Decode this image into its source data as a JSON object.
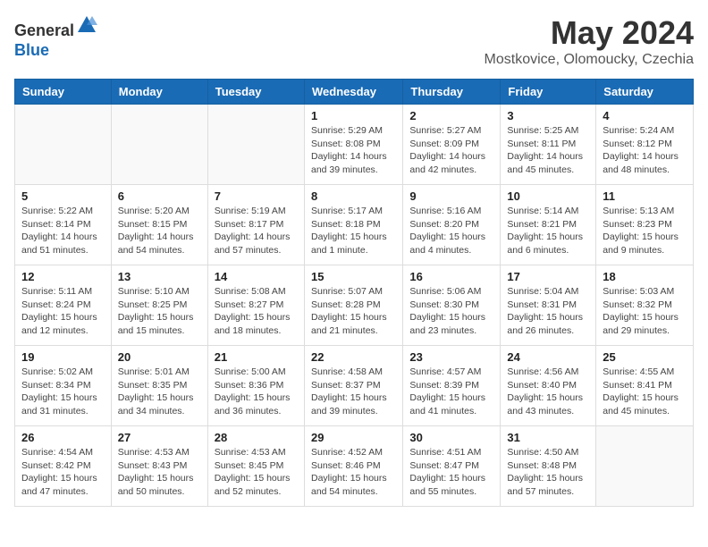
{
  "header": {
    "logo_line1": "General",
    "logo_line2": "Blue",
    "title": "May 2024",
    "location": "Mostkovice, Olomoucky, Czechia"
  },
  "weekdays": [
    "Sunday",
    "Monday",
    "Tuesday",
    "Wednesday",
    "Thursday",
    "Friday",
    "Saturday"
  ],
  "weeks": [
    [
      {
        "day": "",
        "info": ""
      },
      {
        "day": "",
        "info": ""
      },
      {
        "day": "",
        "info": ""
      },
      {
        "day": "1",
        "info": "Sunrise: 5:29 AM\nSunset: 8:08 PM\nDaylight: 14 hours\nand 39 minutes."
      },
      {
        "day": "2",
        "info": "Sunrise: 5:27 AM\nSunset: 8:09 PM\nDaylight: 14 hours\nand 42 minutes."
      },
      {
        "day": "3",
        "info": "Sunrise: 5:25 AM\nSunset: 8:11 PM\nDaylight: 14 hours\nand 45 minutes."
      },
      {
        "day": "4",
        "info": "Sunrise: 5:24 AM\nSunset: 8:12 PM\nDaylight: 14 hours\nand 48 minutes."
      }
    ],
    [
      {
        "day": "5",
        "info": "Sunrise: 5:22 AM\nSunset: 8:14 PM\nDaylight: 14 hours\nand 51 minutes."
      },
      {
        "day": "6",
        "info": "Sunrise: 5:20 AM\nSunset: 8:15 PM\nDaylight: 14 hours\nand 54 minutes."
      },
      {
        "day": "7",
        "info": "Sunrise: 5:19 AM\nSunset: 8:17 PM\nDaylight: 14 hours\nand 57 minutes."
      },
      {
        "day": "8",
        "info": "Sunrise: 5:17 AM\nSunset: 8:18 PM\nDaylight: 15 hours\nand 1 minute."
      },
      {
        "day": "9",
        "info": "Sunrise: 5:16 AM\nSunset: 8:20 PM\nDaylight: 15 hours\nand 4 minutes."
      },
      {
        "day": "10",
        "info": "Sunrise: 5:14 AM\nSunset: 8:21 PM\nDaylight: 15 hours\nand 6 minutes."
      },
      {
        "day": "11",
        "info": "Sunrise: 5:13 AM\nSunset: 8:23 PM\nDaylight: 15 hours\nand 9 minutes."
      }
    ],
    [
      {
        "day": "12",
        "info": "Sunrise: 5:11 AM\nSunset: 8:24 PM\nDaylight: 15 hours\nand 12 minutes."
      },
      {
        "day": "13",
        "info": "Sunrise: 5:10 AM\nSunset: 8:25 PM\nDaylight: 15 hours\nand 15 minutes."
      },
      {
        "day": "14",
        "info": "Sunrise: 5:08 AM\nSunset: 8:27 PM\nDaylight: 15 hours\nand 18 minutes."
      },
      {
        "day": "15",
        "info": "Sunrise: 5:07 AM\nSunset: 8:28 PM\nDaylight: 15 hours\nand 21 minutes."
      },
      {
        "day": "16",
        "info": "Sunrise: 5:06 AM\nSunset: 8:30 PM\nDaylight: 15 hours\nand 23 minutes."
      },
      {
        "day": "17",
        "info": "Sunrise: 5:04 AM\nSunset: 8:31 PM\nDaylight: 15 hours\nand 26 minutes."
      },
      {
        "day": "18",
        "info": "Sunrise: 5:03 AM\nSunset: 8:32 PM\nDaylight: 15 hours\nand 29 minutes."
      }
    ],
    [
      {
        "day": "19",
        "info": "Sunrise: 5:02 AM\nSunset: 8:34 PM\nDaylight: 15 hours\nand 31 minutes."
      },
      {
        "day": "20",
        "info": "Sunrise: 5:01 AM\nSunset: 8:35 PM\nDaylight: 15 hours\nand 34 minutes."
      },
      {
        "day": "21",
        "info": "Sunrise: 5:00 AM\nSunset: 8:36 PM\nDaylight: 15 hours\nand 36 minutes."
      },
      {
        "day": "22",
        "info": "Sunrise: 4:58 AM\nSunset: 8:37 PM\nDaylight: 15 hours\nand 39 minutes."
      },
      {
        "day": "23",
        "info": "Sunrise: 4:57 AM\nSunset: 8:39 PM\nDaylight: 15 hours\nand 41 minutes."
      },
      {
        "day": "24",
        "info": "Sunrise: 4:56 AM\nSunset: 8:40 PM\nDaylight: 15 hours\nand 43 minutes."
      },
      {
        "day": "25",
        "info": "Sunrise: 4:55 AM\nSunset: 8:41 PM\nDaylight: 15 hours\nand 45 minutes."
      }
    ],
    [
      {
        "day": "26",
        "info": "Sunrise: 4:54 AM\nSunset: 8:42 PM\nDaylight: 15 hours\nand 47 minutes."
      },
      {
        "day": "27",
        "info": "Sunrise: 4:53 AM\nSunset: 8:43 PM\nDaylight: 15 hours\nand 50 minutes."
      },
      {
        "day": "28",
        "info": "Sunrise: 4:53 AM\nSunset: 8:45 PM\nDaylight: 15 hours\nand 52 minutes."
      },
      {
        "day": "29",
        "info": "Sunrise: 4:52 AM\nSunset: 8:46 PM\nDaylight: 15 hours\nand 54 minutes."
      },
      {
        "day": "30",
        "info": "Sunrise: 4:51 AM\nSunset: 8:47 PM\nDaylight: 15 hours\nand 55 minutes."
      },
      {
        "day": "31",
        "info": "Sunrise: 4:50 AM\nSunset: 8:48 PM\nDaylight: 15 hours\nand 57 minutes."
      },
      {
        "day": "",
        "info": ""
      }
    ]
  ]
}
